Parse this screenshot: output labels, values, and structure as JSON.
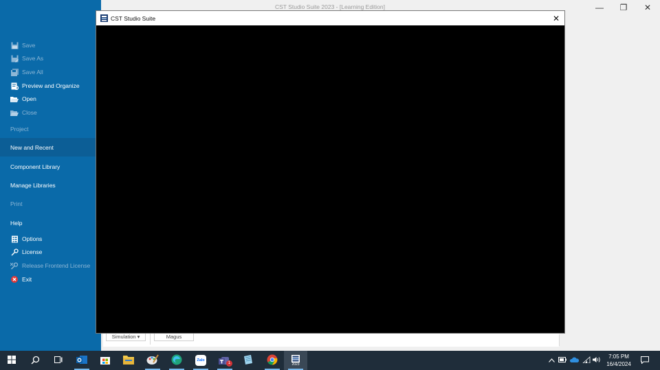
{
  "window": {
    "title": "CST Studio Suite 2023 - [Learning Edition]",
    "minimize_glyph": "—",
    "restore_glyph": "❐",
    "close_glyph": "✕"
  },
  "sidebar": {
    "items": [
      {
        "label": "Save",
        "icon": "save-icon",
        "enabled": false
      },
      {
        "label": "Save As",
        "icon": "save-as-icon",
        "enabled": false
      },
      {
        "label": "Save All",
        "icon": "save-all-icon",
        "enabled": false
      },
      {
        "label": "Preview and Organize",
        "icon": "preview-organize-icon",
        "enabled": true
      },
      {
        "label": "Open",
        "icon": "open-folder-icon",
        "enabled": true
      },
      {
        "label": "Close",
        "icon": "close-folder-icon",
        "enabled": false
      }
    ],
    "sections": [
      {
        "label": "Project",
        "enabled": false
      },
      {
        "label": "New and Recent",
        "enabled": true,
        "selected": true
      },
      {
        "label": "Component Library",
        "enabled": true
      },
      {
        "label": "Manage Libraries",
        "enabled": true
      },
      {
        "label": "Print",
        "enabled": false
      },
      {
        "label": "Help",
        "enabled": true
      }
    ],
    "bottom_items": [
      {
        "label": "Options",
        "icon": "options-icon",
        "enabled": true
      },
      {
        "label": "License",
        "icon": "license-key-icon",
        "enabled": true
      },
      {
        "label": "Release Frontend License",
        "icon": "release-license-icon",
        "enabled": false
      },
      {
        "label": "Exit",
        "icon": "exit-icon",
        "enabled": true
      }
    ]
  },
  "content": {
    "simulation_label": "Simulation ▾",
    "magus_label": "Magus"
  },
  "dialog": {
    "title": "CST Studio Suite",
    "close_glyph": "✕"
  },
  "taskbar": {
    "apps": [
      "start-icon",
      "search-icon",
      "task-view-icon",
      "outlook-icon",
      "store-icon",
      "file-explorer-icon",
      "paint-icon",
      "edge-icon",
      "zalo-icon",
      "teams-icon",
      "notepad-icon",
      "chrome-icon",
      "cst-studio-icon"
    ],
    "teams_badge": "1",
    "zalo_label": "Zalo",
    "cst_label": "2023",
    "time": "7:05 PM",
    "date": "16/4/2024"
  },
  "colors": {
    "sidebar": "#0a6aa9",
    "sidebar_selected": "#0c5e96",
    "taskbar": "#1f2d3a",
    "dialog_body": "#000000"
  }
}
